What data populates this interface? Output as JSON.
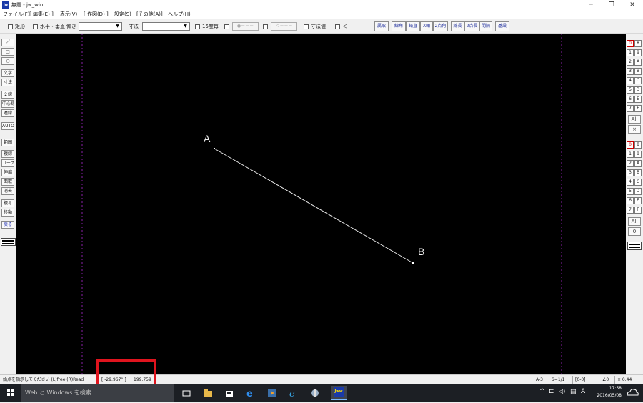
{
  "window": {
    "title": "無題 - jw_win",
    "app_icon_text": "jw"
  },
  "menu": [
    "ファイル(F)",
    "[ 編集(E) ]",
    "表示(V)",
    "[ 作図(D) ]",
    "設定(S)",
    "[その他(A)]",
    "ヘルプ(H)"
  ],
  "toolbar": {
    "rect_label": "矩形",
    "hv_label": "水平・垂直",
    "slope_label": "傾き",
    "dim_label": "寸法",
    "deg15_label": "15度毎",
    "btn_disabled_1": "●－－－",
    "btn_disabled_2": "＜－－－",
    "dimvalue_label": "寸法値",
    "arrow_label": "＜",
    "right_buttons": [
      "属取",
      "線角",
      "鉛直",
      "X軸",
      "2点角",
      "線長",
      "2点長",
      "間隔",
      "基設"
    ]
  },
  "left_tools": {
    "group1": [
      "／",
      "□",
      "○",
      "文字",
      "寸法",
      "２線",
      "中心線",
      "連線",
      "AUTO"
    ],
    "group2": [
      "範囲",
      "複線",
      "コーナー",
      "伸縮",
      "面取",
      "消去",
      "複写",
      "移動",
      "戻る"
    ]
  },
  "right_palette": {
    "layer_groups": [
      [
        "0",
        "8"
      ],
      [
        "1",
        "9"
      ],
      [
        "2",
        "A"
      ],
      [
        "3",
        "B"
      ],
      [
        "4",
        "C"
      ],
      [
        "5",
        "D"
      ],
      [
        "6",
        "E"
      ],
      [
        "7",
        "F"
      ]
    ],
    "all_label": "All",
    "x_label": "×",
    "layer_groups_2": [
      [
        "0",
        "8"
      ],
      [
        "1",
        "9"
      ],
      [
        "2",
        "A"
      ],
      [
        "3",
        "B"
      ],
      [
        "4",
        "C"
      ],
      [
        "5",
        "D"
      ],
      [
        "6",
        "E"
      ],
      [
        "7",
        "F"
      ]
    ],
    "all_label_2": "All",
    "zero_label": "0"
  },
  "drawing": {
    "point_a_label": "A",
    "point_b_label": "B"
  },
  "status": {
    "message": "始点を指示してください (L)free (R)Read",
    "coord_x": "[ -29.967° ]",
    "coord_y": "199.759",
    "paper": "A-3",
    "scale": "S=1/1",
    "layer": "[0-0]",
    "angle": "∠0",
    "zoom": "× 0.44"
  },
  "taskbar": {
    "search_placeholder": "Web と Windows を検索",
    "time": "17:58",
    "date": "2016/05/08",
    "ime": "A"
  },
  "colors": {
    "canvas": "#000000",
    "highlight": "#e0141e",
    "taskbar": "#1c1f24"
  }
}
